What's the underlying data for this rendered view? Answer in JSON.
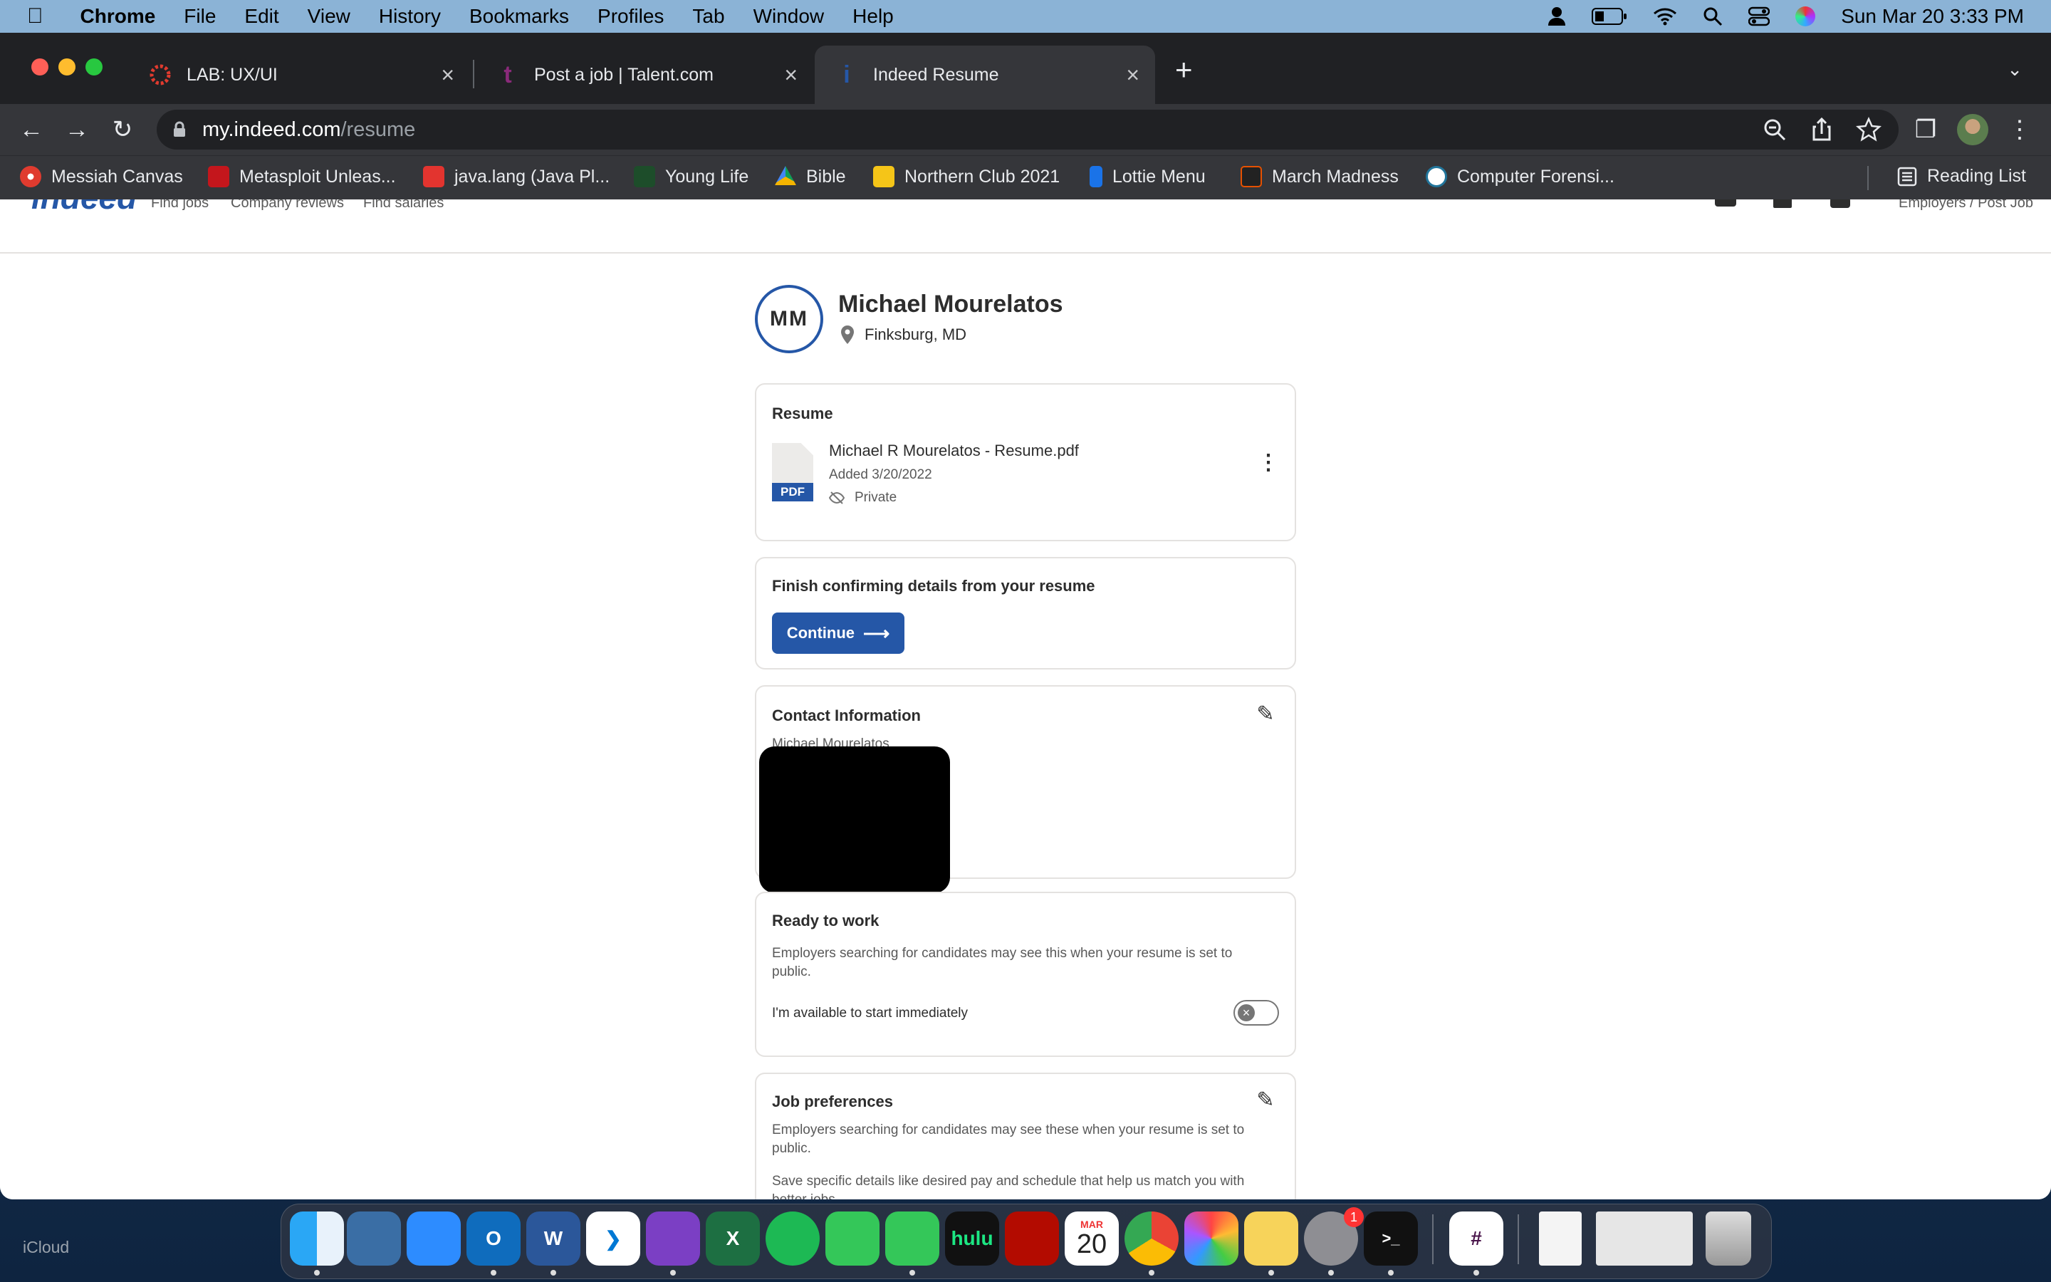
{
  "menubar": {
    "app": "Chrome",
    "items": [
      "File",
      "Edit",
      "View",
      "History",
      "Bookmarks",
      "Profiles",
      "Tab",
      "Window",
      "Help"
    ],
    "datetime": "Sun Mar 20  3:33 PM"
  },
  "tabs": [
    {
      "title": "LAB: UX/UI",
      "favicon": "canvas-icon",
      "color": "#e03b2f"
    },
    {
      "title": "Post a job | Talent.com",
      "favicon": "talent-icon",
      "color": "#8a2a7a"
    },
    {
      "title": "Indeed Resume",
      "favicon": "indeed-icon",
      "color": "#2557a7"
    }
  ],
  "new_tab_symbol": "+",
  "address": {
    "domain": "my.indeed.com",
    "path": "/resume"
  },
  "bookmarks": [
    {
      "label": "Messiah Canvas",
      "color": "#e03b2f"
    },
    {
      "label": "Metasploit Unleas...",
      "color": "#c4161c"
    },
    {
      "label": "java.lang (Java Pl...",
      "color": "#e3342f"
    },
    {
      "label": "Young Life",
      "color": "#9ccc3c"
    },
    {
      "label": "Bible",
      "color": "#4a90e2"
    },
    {
      "label": "Northern Club 2021",
      "color": "#f5c518"
    },
    {
      "label": "Lottie Menu",
      "color": "#1a73e8"
    },
    {
      "label": "March Madness",
      "color": "#e65100"
    },
    {
      "label": "Computer Forensi...",
      "color": "#ffffff"
    }
  ],
  "reading_list": "Reading List",
  "indeed_nav": {
    "logo": "indeed",
    "links": [
      "Find jobs",
      "Company reviews",
      "Find salaries"
    ],
    "employers": "Employers / Post Job"
  },
  "profile": {
    "initials": "MM",
    "name": "Michael Mourelatos",
    "location": "Finksburg, MD"
  },
  "resume": {
    "heading": "Resume",
    "filename": "Michael R Mourelatos - Resume.pdf",
    "added": "Added 3/20/2022",
    "visibility": "Private",
    "file_badge": "PDF"
  },
  "finish": {
    "heading": "Finish confirming details from your resume",
    "button": "Continue"
  },
  "contact": {
    "heading": "Contact Information",
    "name": "Michael Mourelatos"
  },
  "ready": {
    "heading": "Ready to work",
    "desc": "Employers searching for candidates may see this when your resume is set to public.",
    "toggle_label": "I'm available to start immediately",
    "toggle_on": false
  },
  "prefs": {
    "heading": "Job preferences",
    "desc": "Employers searching for candidates may see these when your resume is set to public.",
    "desc2": "Save specific details like desired pay and schedule that help us match you with better jobs"
  },
  "icloud": "iCloud",
  "dock": {
    "calendar_month": "MAR",
    "calendar_day": "20",
    "badge": "1",
    "hulu": "hulu"
  }
}
